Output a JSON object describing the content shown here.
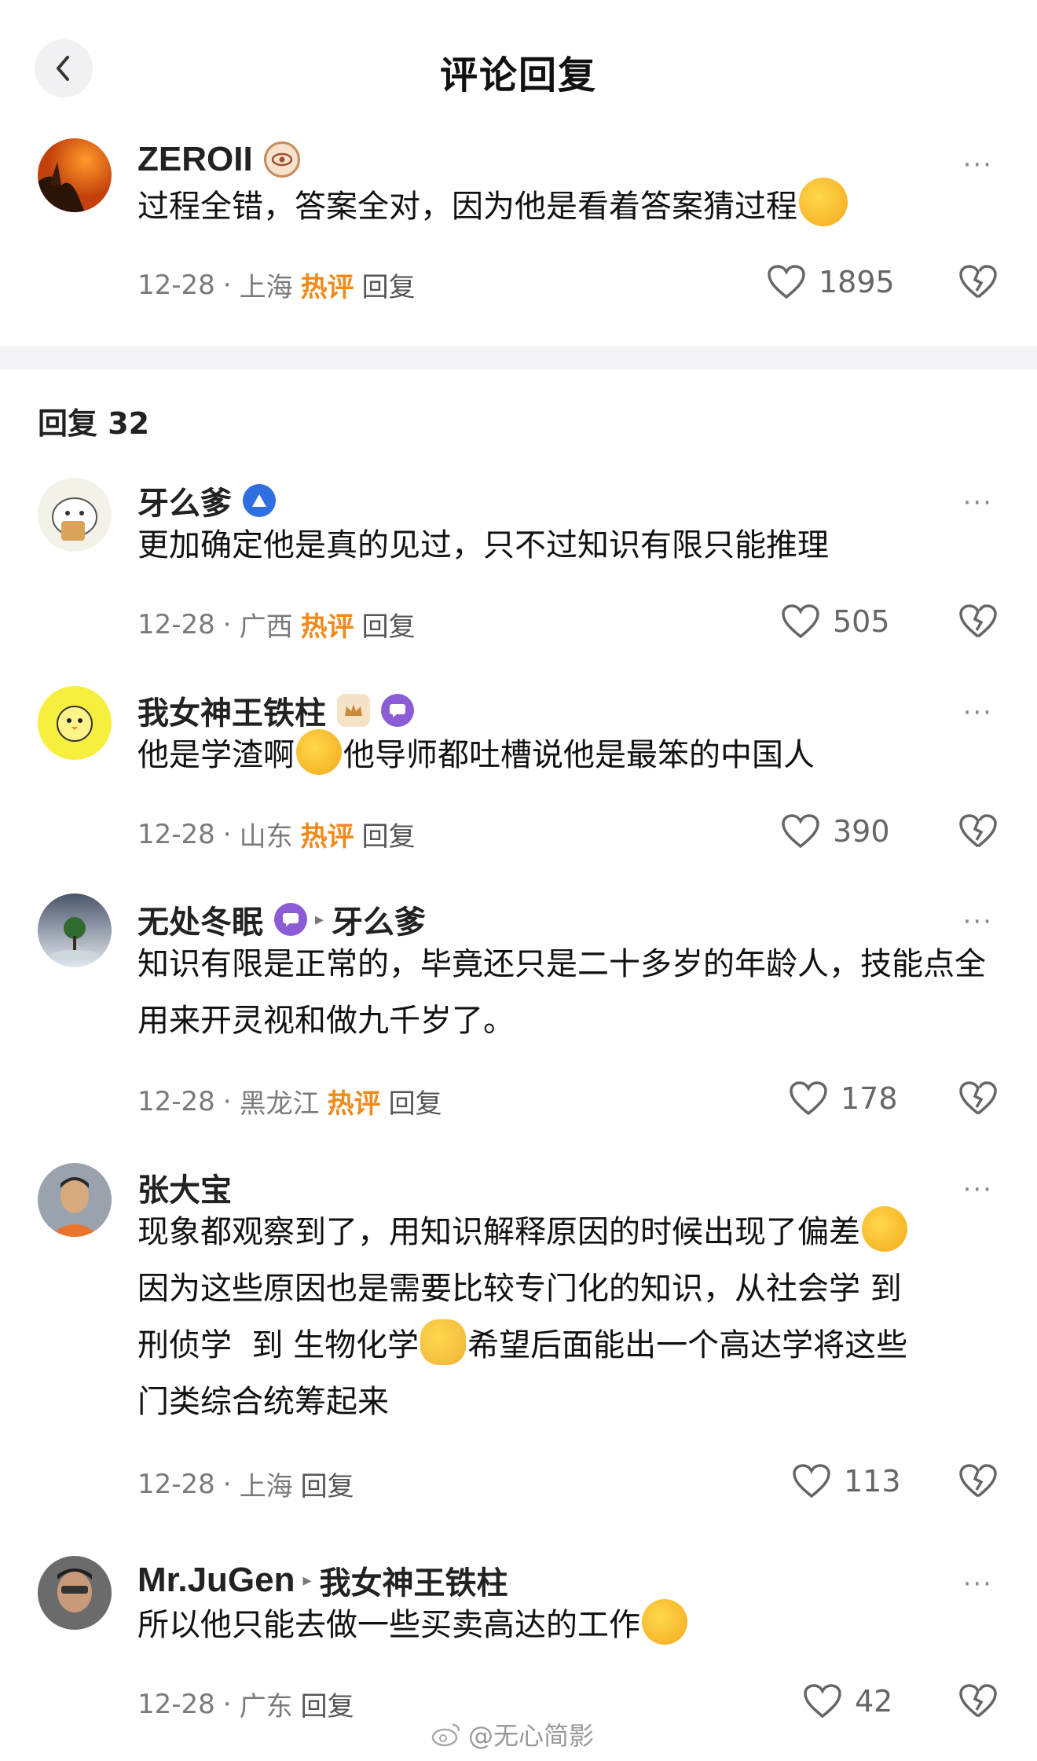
{
  "header": {
    "title": "评论回复"
  },
  "main_comment": {
    "name": "ZEROII",
    "text": "过程全错，答案全对，因为他是看着答案猜过程",
    "date": "12-28",
    "location": "上海",
    "hot_label": "热评",
    "reply_label": "回复",
    "likes": "1895"
  },
  "replies": {
    "count_label": "回复 32",
    "items": [
      {
        "name": "牙么爹",
        "text": "更加确定他是真的见过，只不过知识有限只能推理",
        "date": "12-28",
        "location": "广西",
        "hot_label": "热评",
        "reply_label": "回复",
        "likes": "505"
      },
      {
        "name": "我女神王铁柱",
        "text_a": "他是学渣啊",
        "text_b": "他导师都吐槽说他是最笨的中国人",
        "date": "12-28",
        "location": "山东",
        "hot_label": "热评",
        "reply_label": "回复",
        "likes": "390"
      },
      {
        "name": "无处冬眠",
        "reply_to": "牙么爹",
        "text": "知识有限是正常的，毕竟还只是二十多岁的年龄人，技能点全用来开灵视和做九千岁了。",
        "date": "12-28",
        "location": "黑龙江",
        "hot_label": "热评",
        "reply_label": "回复",
        "likes": "178"
      },
      {
        "name": "张大宝",
        "line1": "现象都观察到了，用知识解释原因的时候出现了偏差",
        "line2": "因为这些原因也是需要比较专门化的知识，从社会学 到",
        "line3a": "刑侦学  到 生物化学",
        "line3b": "希望后面能出一个高达学将这些",
        "line4": "门类综合统筹起来",
        "date": "12-28",
        "location": "上海",
        "reply_label": "回复",
        "likes": "113"
      },
      {
        "name": "Mr.JuGen",
        "reply_to": "我女神王铁柱",
        "text": "所以他只能去做一些买卖高达的工作",
        "date": "12-28",
        "location": "广东",
        "reply_label": "回复",
        "likes": "42"
      }
    ]
  },
  "watermark": "@无心简影",
  "colors": {
    "hot": "#f08a1a",
    "text": "#111111",
    "meta": "#7a7a7a",
    "divider": "#f3f3f5"
  }
}
